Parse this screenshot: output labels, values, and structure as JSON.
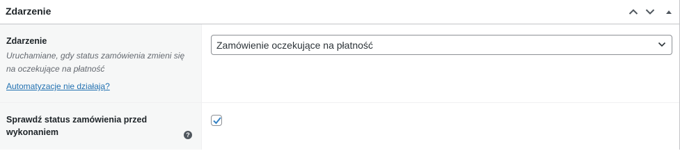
{
  "panel": {
    "title": "Zdarzenie",
    "actions": {
      "move_up_icon": "chevron-up-icon",
      "move_down_icon": "chevron-down-icon",
      "toggle_icon": "triangle-up-icon"
    }
  },
  "event_field": {
    "label": "Zdarzenie",
    "description": "Uruchamiane, gdy status zamówienia zmieni się na oczekujące na płatność",
    "help_link": "Automatyzacje nie działają?",
    "selected": "Zamówienie oczekujące na płatność"
  },
  "check_status_field": {
    "label": "Sprawdź status zamówienia przed wykonaniem",
    "checked": true,
    "help_icon": "question-mark-icon"
  },
  "colors": {
    "accent": "#2271b1",
    "label_background": "#f6f7f7",
    "border": "#c3c4c7"
  }
}
